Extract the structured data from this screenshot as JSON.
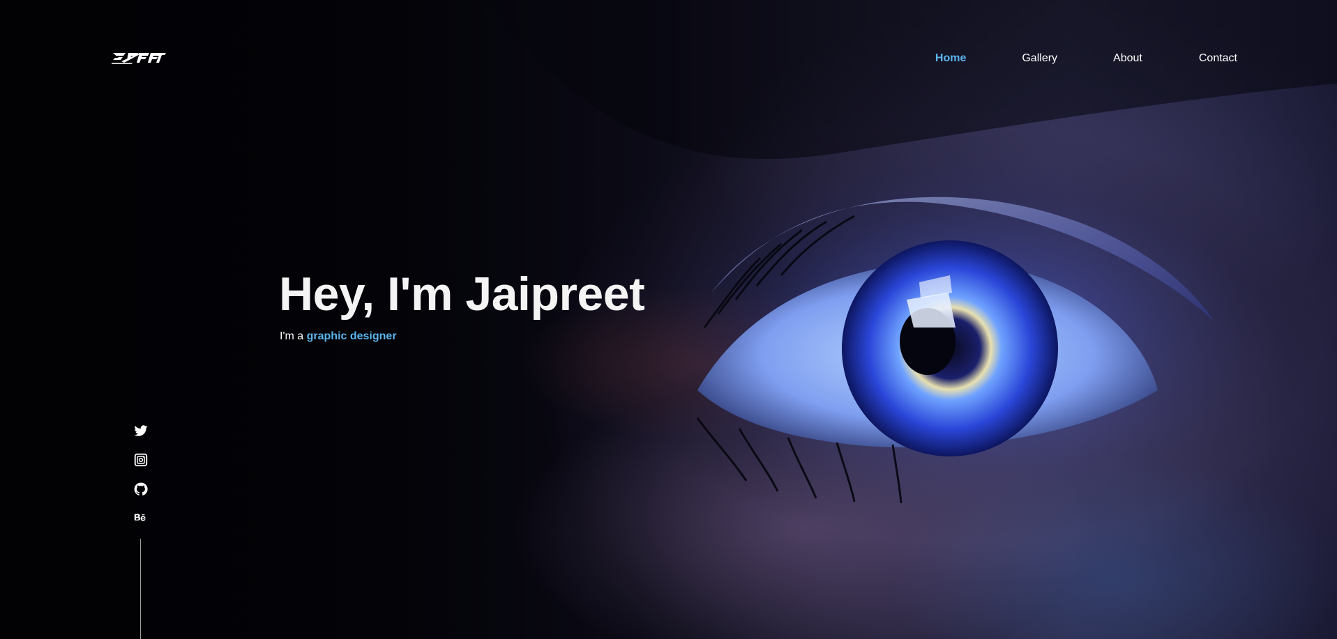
{
  "header": {
    "logo_alt": "JPREET",
    "nav": [
      {
        "label": "Home",
        "active": true
      },
      {
        "label": "Gallery",
        "active": false
      },
      {
        "label": "About",
        "active": false
      },
      {
        "label": "Contact",
        "active": false
      }
    ]
  },
  "hero": {
    "title": "Hey, I'm Jaipreet",
    "subtitle_prefix": "I'm a ",
    "subtitle_highlight": "graphic designer"
  },
  "social": [
    {
      "icon": "twitter-icon"
    },
    {
      "icon": "instagram-icon"
    },
    {
      "icon": "github-icon"
    },
    {
      "icon": "behance-icon"
    }
  ],
  "colors": {
    "accent": "#5bb5ec",
    "background": "#020205",
    "text": "#ffffff"
  }
}
